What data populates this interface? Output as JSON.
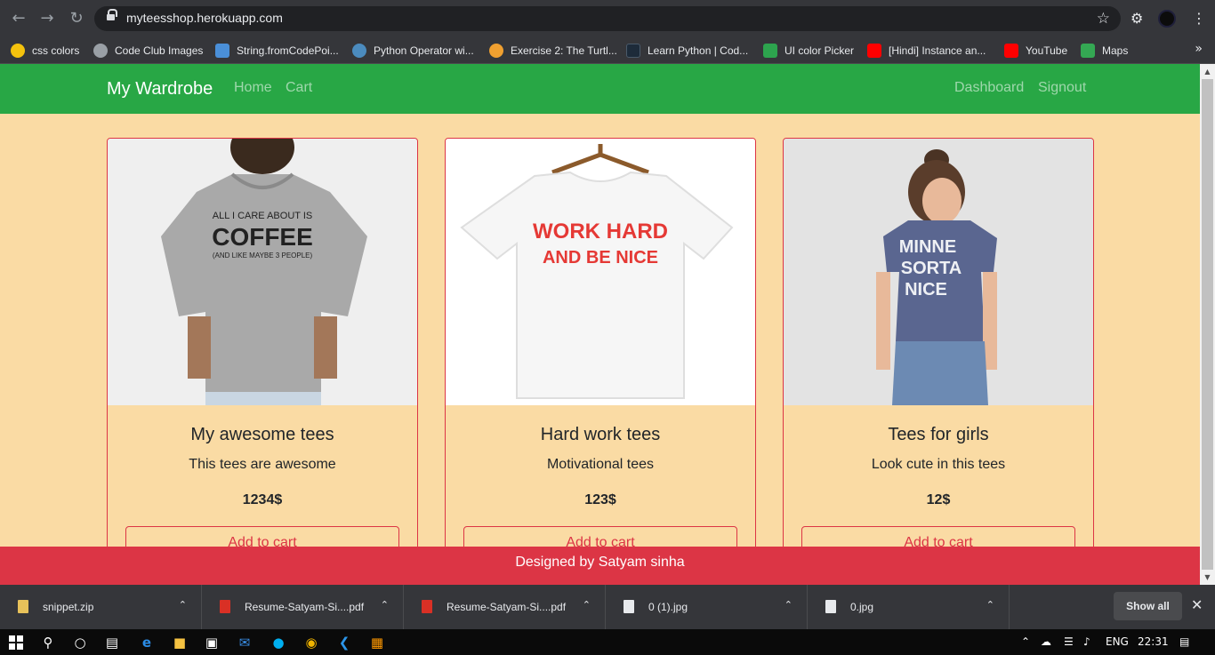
{
  "browser": {
    "url": "myteesshop.herokuapp.com",
    "bookmarks": [
      {
        "label": "css colors",
        "color": "#f4c20d"
      },
      {
        "label": "Code Club Images",
        "color": "#9aa0a6"
      },
      {
        "label": "String.fromCodePoi...",
        "color": "#4a8fd8"
      },
      {
        "label": "Python Operator wi...",
        "color": "#4b8bbe"
      },
      {
        "label": "Exercise 2: The Turtl...",
        "color": "#f0a030"
      },
      {
        "label": "Learn Python | Cod...",
        "color": "#1d2b3a"
      },
      {
        "label": "UI color Picker",
        "color": "#2da44e"
      },
      {
        "label": "[Hindi] Instance an...",
        "color": "#ff0000"
      },
      {
        "label": "YouTube",
        "color": "#ff0000"
      },
      {
        "label": "Maps",
        "color": "#34a853"
      }
    ]
  },
  "navbar": {
    "brand": "My Wardrobe",
    "links": [
      "Home",
      "Cart"
    ],
    "right_links": [
      "Dashboard",
      "Signout"
    ],
    "color": "#28a745"
  },
  "products": [
    {
      "title": "My awesome tees",
      "description": "This tees are awesome",
      "price": "1234$",
      "button": "Add to cart",
      "shirt_text": [
        "ALL I CARE ABOUT IS",
        "COFFEE",
        "(AND LIKE MAYBE 3 PEOPLE)"
      ]
    },
    {
      "title": "Hard work tees",
      "description": "Motivational tees",
      "price": "123$",
      "button": "Add to cart",
      "shirt_text": [
        "WORK HARD",
        "AND BE NICE"
      ]
    },
    {
      "title": "Tees for girls",
      "description": "Look cute in this tees",
      "price": "12$",
      "button": "Add to cart",
      "shirt_text": [
        "MINNE",
        "SORTA",
        "NICE"
      ]
    }
  ],
  "footer": {
    "text": "Designed by Satyam sinha",
    "color": "#dc3545"
  },
  "downloads": {
    "items": [
      "snippet.zip",
      "Resume-Satyam-Si....pdf",
      "Resume-Satyam-Si....pdf",
      "0 (1).jpg",
      "0.jpg"
    ],
    "show_all": "Show all"
  },
  "taskbar": {
    "language": "ENG",
    "time": "22:31"
  }
}
